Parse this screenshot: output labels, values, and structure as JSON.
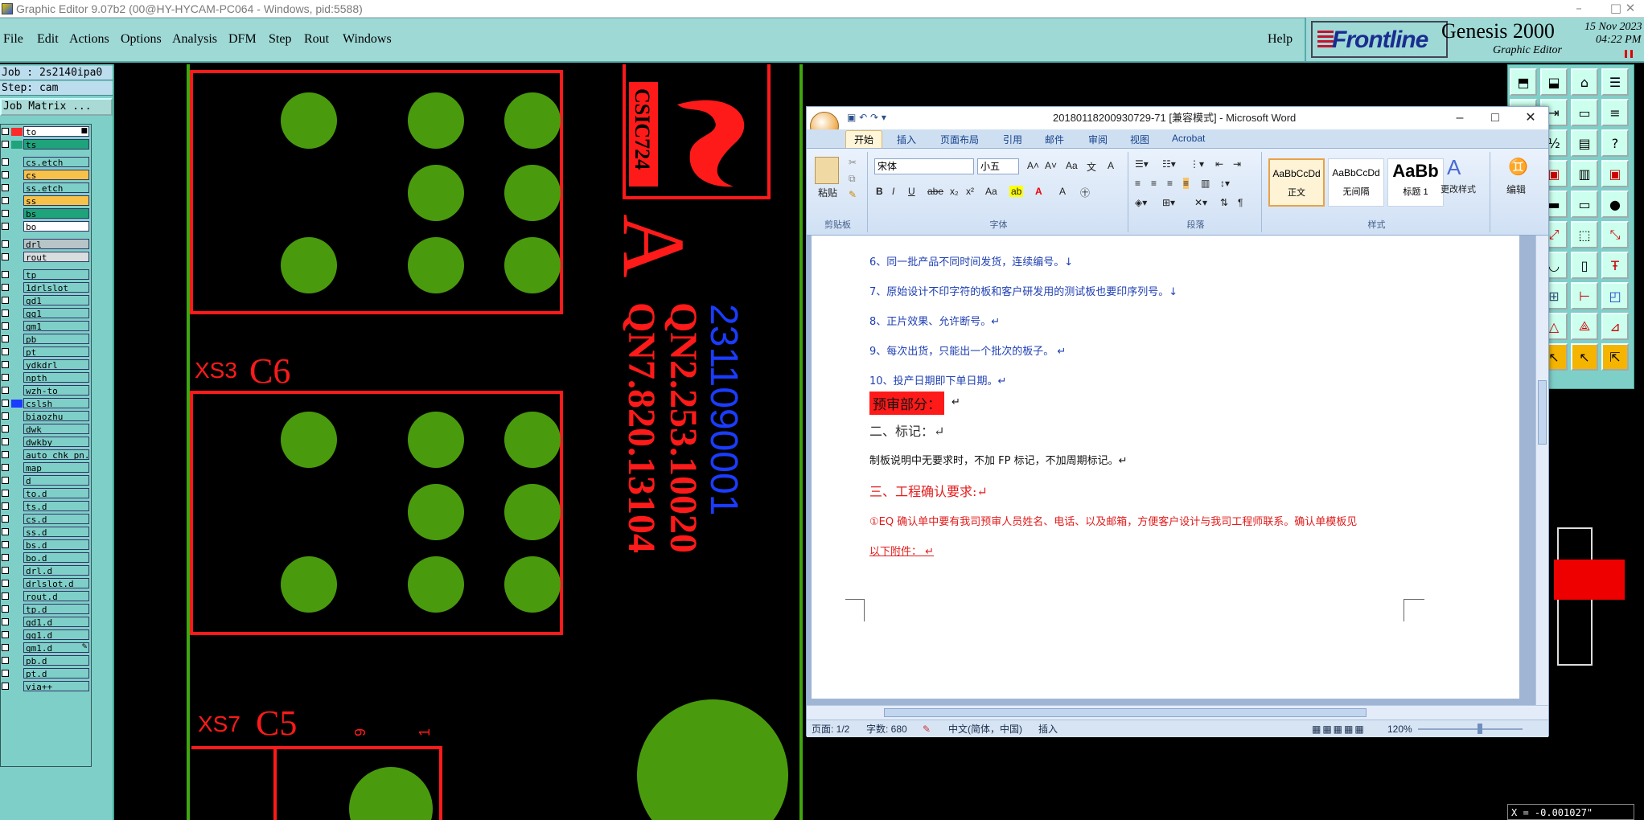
{
  "titlebar": {
    "title": "Graphic Editor 9.07b2 (00@HY-HYCAM-PC064 - Windows, pid:5588)",
    "minimize": "–",
    "maximize": "□",
    "close": "✕"
  },
  "menu": {
    "items": [
      "File",
      "Edit",
      "Actions",
      "Options",
      "Analysis",
      "DFM",
      "Step",
      "Rout",
      "Windows"
    ],
    "help": "Help"
  },
  "brand": {
    "logo": "Frontline",
    "product": "Genesis 2000",
    "subtitle": "Graphic Editor",
    "date": "15 Nov 2023",
    "time": "04:22 PM"
  },
  "job": {
    "job_line": "Job : 2s2140ipa0",
    "step_line": "Step: cam",
    "job_matrix": "Job Matrix ..."
  },
  "layers": [
    {
      "name": "to",
      "color": "#ff2a2a",
      "bg": "#ffffff",
      "marker": "■"
    },
    {
      "name": "ts",
      "color": "#1fa37a",
      "bg": "#1fa37a"
    },
    {
      "name": "cs.etch",
      "color": "",
      "bg": "#7fcfc9"
    },
    {
      "name": "cs",
      "color": "",
      "bg": "#f7c24a"
    },
    {
      "name": "ss.etch",
      "color": "",
      "bg": "#7fcfc9"
    },
    {
      "name": "ss",
      "color": "",
      "bg": "#f7c24a"
    },
    {
      "name": "bs",
      "color": "",
      "bg": "#1fa37a"
    },
    {
      "name": "bo",
      "color": "",
      "bg": "#ffffff"
    },
    {
      "name": "drl",
      "color": "",
      "bg": "#b7c5c8"
    },
    {
      "name": "rout",
      "color": "",
      "bg": "#d8dede"
    },
    {
      "name": "tp",
      "color": "",
      "bg": "#7fcfc9"
    },
    {
      "name": "1drlslot",
      "color": "",
      "bg": "#7fcfc9"
    },
    {
      "name": "gd1",
      "color": "",
      "bg": "#7fcfc9"
    },
    {
      "name": "gg1",
      "color": "",
      "bg": "#7fcfc9"
    },
    {
      "name": "gm1",
      "color": "",
      "bg": "#7fcfc9"
    },
    {
      "name": "pb",
      "color": "",
      "bg": "#7fcfc9"
    },
    {
      "name": "pt",
      "color": "",
      "bg": "#7fcfc9"
    },
    {
      "name": "ydkdrl",
      "color": "",
      "bg": "#7fcfc9"
    },
    {
      "name": "npth",
      "color": "",
      "bg": "#7fcfc9"
    },
    {
      "name": "wzh-to",
      "color": "",
      "bg": "#7fcfc9"
    },
    {
      "name": "cslsh",
      "color": "#1a3cff",
      "bg": "#7fcfc9"
    },
    {
      "name": "biaozhu",
      "color": "",
      "bg": "#7fcfc9"
    },
    {
      "name": "dwk",
      "color": "",
      "bg": "#7fcfc9"
    },
    {
      "name": "dwkby",
      "color": "",
      "bg": "#7fcfc9"
    },
    {
      "name": "auto_chk_pn.",
      "color": "",
      "bg": "#7fcfc9"
    },
    {
      "name": "map",
      "color": "",
      "bg": "#7fcfc9"
    },
    {
      "name": "d",
      "color": "",
      "bg": "#7fcfc9"
    },
    {
      "name": "to.d",
      "color": "",
      "bg": "#7fcfc9"
    },
    {
      "name": "ts.d",
      "color": "",
      "bg": "#7fcfc9"
    },
    {
      "name": "cs.d",
      "color": "",
      "bg": "#7fcfc9"
    },
    {
      "name": "ss.d",
      "color": "",
      "bg": "#7fcfc9"
    },
    {
      "name": "bs.d",
      "color": "",
      "bg": "#7fcfc9"
    },
    {
      "name": "bo.d",
      "color": "",
      "bg": "#7fcfc9"
    },
    {
      "name": "drl.d",
      "color": "",
      "bg": "#7fcfc9"
    },
    {
      "name": "drlslot.d",
      "color": "",
      "bg": "#7fcfc9"
    },
    {
      "name": "rout.d",
      "color": "",
      "bg": "#7fcfc9"
    },
    {
      "name": "tp.d",
      "color": "",
      "bg": "#7fcfc9"
    },
    {
      "name": "gd1.d",
      "color": "",
      "bg": "#7fcfc9"
    },
    {
      "name": "gg1.d",
      "color": "",
      "bg": "#7fcfc9"
    },
    {
      "name": "gm1.d",
      "color": "",
      "bg": "#7fcfc9",
      "marker": "✎"
    },
    {
      "name": "pb.d",
      "color": "",
      "bg": "#7fcfc9"
    },
    {
      "name": "pt.d",
      "color": "",
      "bg": "#7fcfc9"
    },
    {
      "name": "via++",
      "color": "",
      "bg": "#7fcfc9"
    }
  ],
  "pcb": {
    "label_xs3": "XS3",
    "label_c6": "C6",
    "label_xs7": "XS7",
    "label_c5": "C5",
    "label_9": "9",
    "label_1": "1",
    "marking_csic": "CSIC724",
    "marking_a": "A",
    "marking_qn2": "QN2.253.10020",
    "marking_qn7": "QN7.820.13104",
    "marking_serial": "2311090001",
    "colors": {
      "pad": "#4a9a0e",
      "outline": "#ff1a1a",
      "serial": "#1a3cff",
      "board_edge": "#3fa60e"
    }
  },
  "coords": {
    "x_readout": "X = -0.001027\""
  },
  "word": {
    "title": "20180118200930729-71 [兼容模式] - Microsoft Word",
    "tabs": [
      "开始",
      "插入",
      "页面布局",
      "引用",
      "邮件",
      "审阅",
      "视图",
      "Acrobat"
    ],
    "ribbon": {
      "clipboard": "剪贴板",
      "paste": "粘贴",
      "font_group": "字体",
      "paragraph_group": "段落",
      "styles_group": "样式",
      "edit_group": "编辑",
      "font_name": "宋体",
      "font_size": "小五",
      "style_normal_sample": "AaBbCcDd",
      "style_normal": "正文",
      "style_nospace_sample": "AaBbCcDd",
      "style_nospace": "无间隔",
      "style_h1_sample": "AaBb",
      "style_h1": "标题 1",
      "change_styles": "更改样式",
      "edit": "编辑"
    },
    "doc": {
      "l6": "6、同一批产品不同时间发货，连续编号。↓",
      "l7": "7、原始设计不印字符的板和客户研发用的测试板也要印序列号。↓",
      "l8": "8、正片效果、允许断号。↵",
      "l9": "9、每次出货，只能出一个批次的板子。  ↵",
      "l10": "10、投产日期即下单日期。↵",
      "review": "预审部分：",
      "review_tail": "↵",
      "h2": "二、标记：↵",
      "p2": "制板说明中无要求时，不加 FP 标记，不加周期标记。↵",
      "h3": "三、工程确认要求:↵",
      "p3": "①EQ 确认单中要有我司预审人员姓名、电话、以及邮箱，方便客户设计与我司工程师联系。确认单模板见",
      "p3b": "以下附件：  ↵"
    },
    "status": {
      "page": "页面: 1/2",
      "words": "字数: 680",
      "lang": "中文(简体，中国)",
      "mode": "插入",
      "zoom": "120%"
    }
  }
}
